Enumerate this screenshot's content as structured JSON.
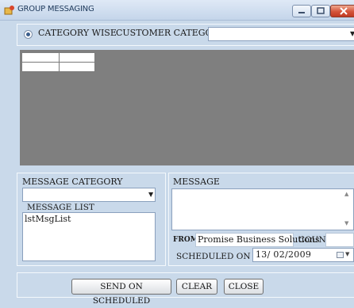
{
  "window": {
    "title": "GROUP MESSAGING"
  },
  "filter": {
    "radio_label": "CATEGORY WISE",
    "radio_selected": true,
    "customer_category_label": "CUSTOMER CATEGORY",
    "customer_category_value": ""
  },
  "message_category": {
    "label": "MESSAGE CATEGORY",
    "selected": "",
    "list_label": "MESSAGE LIST",
    "list_items": [
      "lstMsgList"
    ]
  },
  "message": {
    "label": "MESSAGE",
    "text": "",
    "from_label": "FROM",
    "from_value": "Promise Business Solutions",
    "count_label": "COUNT",
    "count_value": "",
    "scheduled_label": "SCHEDULED ON",
    "scheduled_date": "13/ 02/2009"
  },
  "buttons": {
    "send_label": "SEND ON SCHEDULED",
    "clear_label": "CLEAR",
    "close_label": "CLOSE"
  },
  "icons": {
    "app": "app-icon",
    "minimize": "minimize-icon",
    "maximize": "maximize-icon",
    "close": "close-icon",
    "dropdown": "chevron-down-icon",
    "calendar": "calendar-icon"
  },
  "colors": {
    "window_bg": "#c9d9ea",
    "grid_bg": "#7f7f7f",
    "close_button": "#d4533a"
  }
}
